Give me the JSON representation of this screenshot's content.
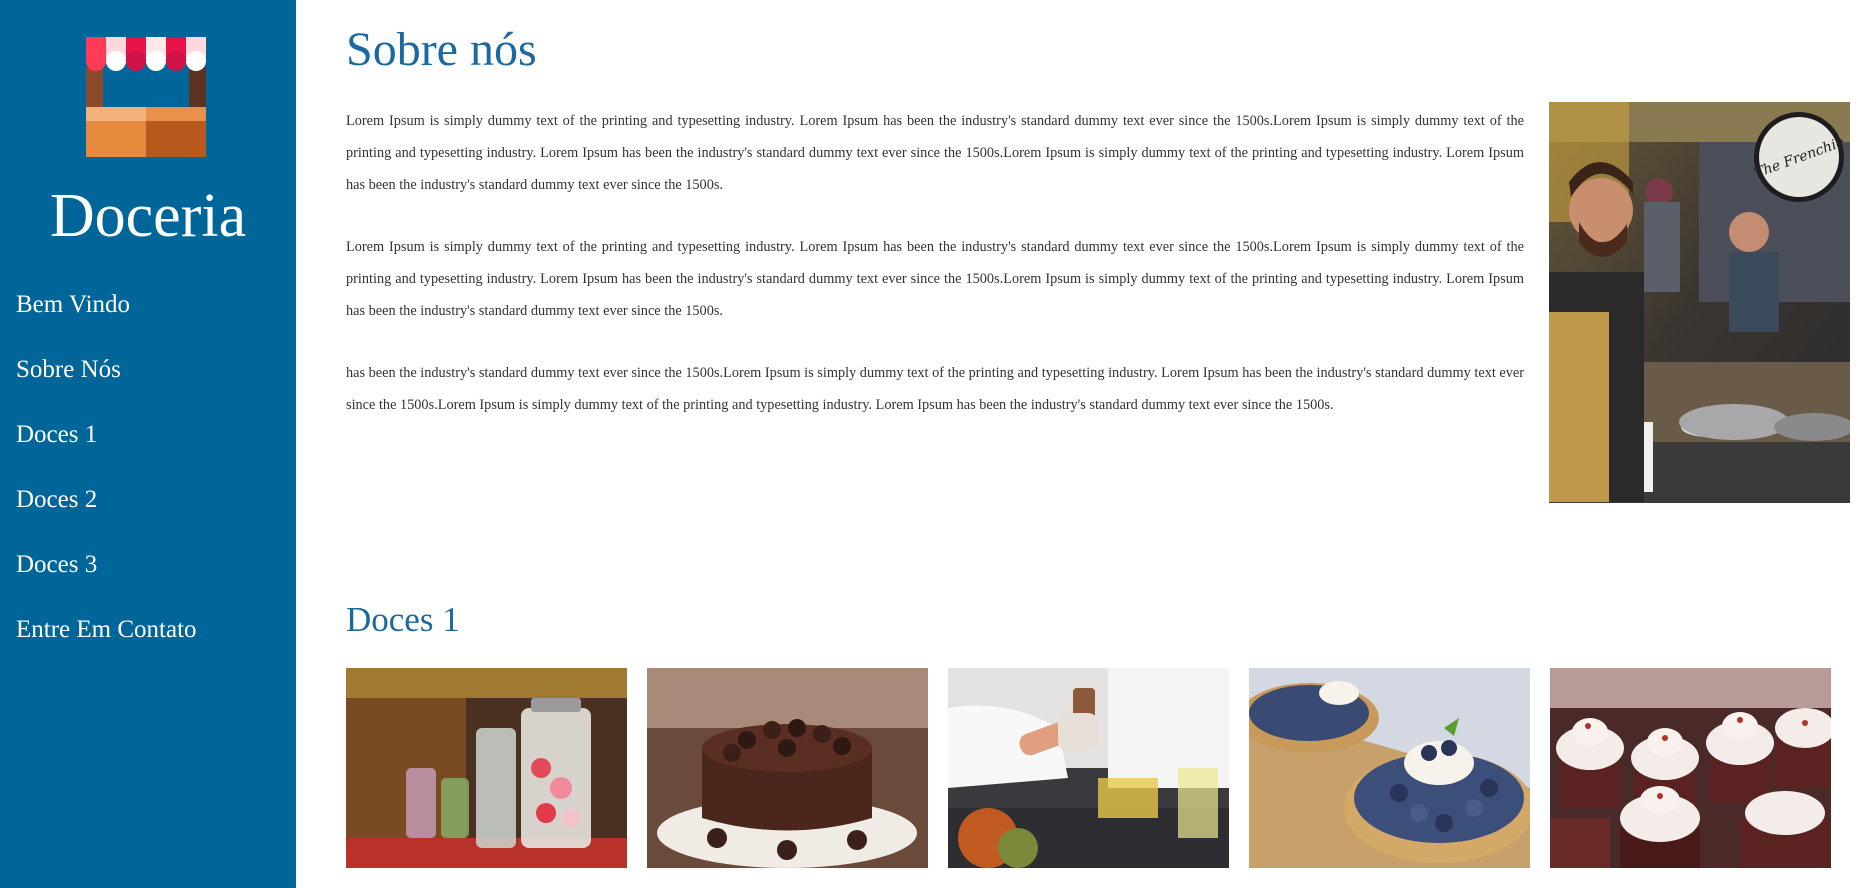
{
  "sidebar": {
    "brand": "Doceria",
    "logo_icon": "market-stall-icon",
    "nav": [
      {
        "label": "Bem Vindo"
      },
      {
        "label": "Sobre Nós"
      },
      {
        "label": "Doces 1"
      },
      {
        "label": "Doces 2"
      },
      {
        "label": "Doces 3"
      },
      {
        "label": "Entre Em Contato"
      }
    ]
  },
  "about": {
    "title": "Sobre nós",
    "paragraphs": [
      "Lorem Ipsum is simply dummy text of the printing and typesetting industry. Lorem Ipsum has been the industry's standard dummy text ever since the 1500s.Lorem Ipsum is simply dummy text of the printing and typesetting industry. Lorem Ipsum has been the industry's standard dummy text ever since the 1500s.Lorem Ipsum is simply dummy text of the printing and typesetting industry. Lorem Ipsum has been the industry's standard dummy text ever since the 1500s.",
      "Lorem Ipsum is simply dummy text of the printing and typesetting industry. Lorem Ipsum has been the industry's standard dummy text ever since the 1500s.Lorem Ipsum is simply dummy text of the printing and typesetting industry. Lorem Ipsum has been the industry's standard dummy text ever since the 1500s.Lorem Ipsum is simply dummy text of the printing and typesetting industry. Lorem Ipsum has been the industry's standard dummy text ever since the 1500s.",
      "has been the industry's standard dummy text ever since the 1500s.Lorem Ipsum is simply dummy text of the printing and typesetting industry. Lorem Ipsum has been the industry's standard dummy text ever since the 1500s.Lorem Ipsum is simply dummy text of the printing and typesetting industry. Lorem Ipsum has been the industry's standard dummy text ever since the 1500s."
    ],
    "hero_sign_text": "The Frenchie"
  },
  "doces1": {
    "title": "Doces 1"
  },
  "colors": {
    "sidebar": "#006699",
    "heading": "#1a6aa0"
  }
}
